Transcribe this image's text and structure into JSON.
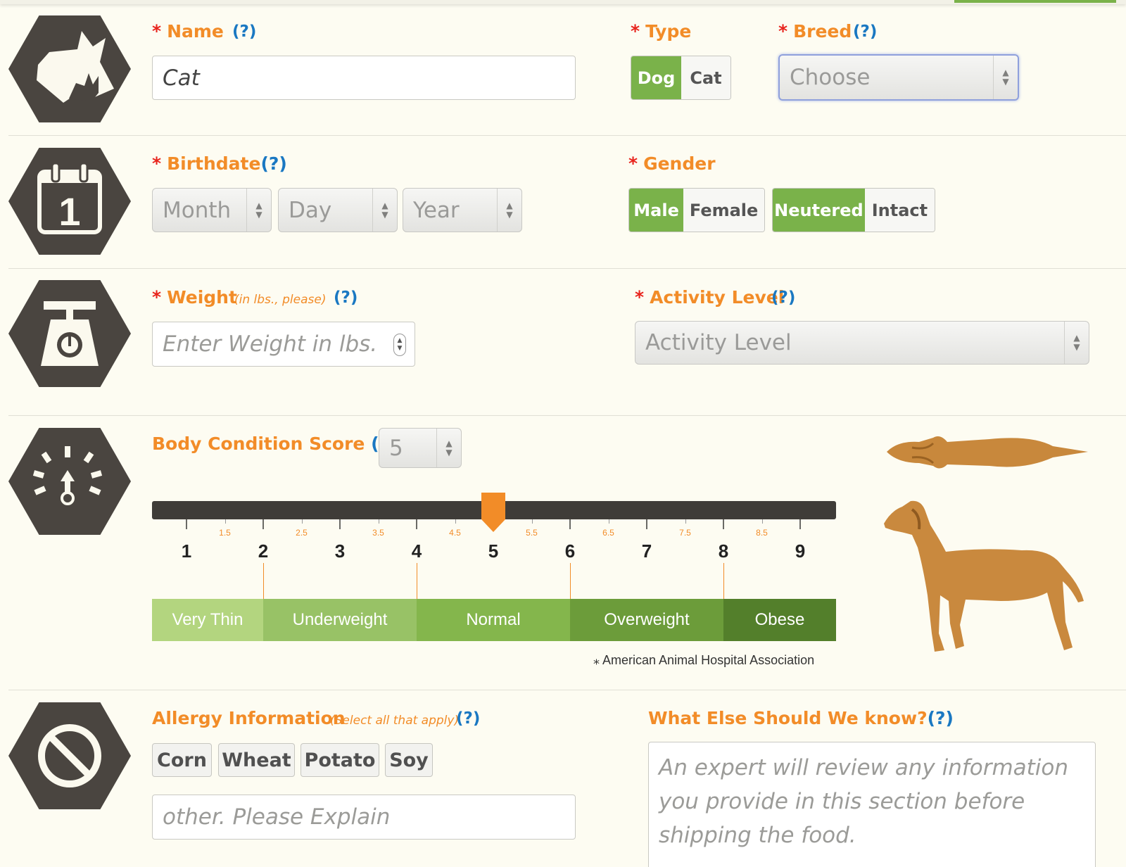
{
  "name_field": {
    "label": "Name",
    "help": "(?)",
    "value": "Cat"
  },
  "type_field": {
    "label": "Type",
    "options": [
      "Dog",
      "Cat"
    ],
    "selected": "Dog"
  },
  "breed_field": {
    "label": "Breed",
    "help": "(?)",
    "value": "Choose"
  },
  "birthdate_field": {
    "label": "Birthdate",
    "help": "(?)",
    "month": "Month",
    "day": "Day",
    "year": "Year"
  },
  "gender_field": {
    "label": "Gender",
    "sex_options": [
      "Male",
      "Female"
    ],
    "sex_selected": "Male",
    "status_options": [
      "Neutered",
      "Intact"
    ],
    "status_selected": "Neutered"
  },
  "weight_field": {
    "label": "Weight",
    "note": "(in lbs., please)",
    "help": "(?)",
    "placeholder": "Enter Weight in lbs."
  },
  "activity_field": {
    "label": "Activity Level",
    "help": "(?)",
    "value": "Activity Level"
  },
  "bcs": {
    "label": "Body Condition Score",
    "help": "(?)",
    "value": "5",
    "major_ticks": [
      "1",
      "2",
      "3",
      "4",
      "5",
      "6",
      "7",
      "8",
      "9"
    ],
    "minor_ticks": [
      "1.5",
      "2.5",
      "3.5",
      "4.5",
      "5.5",
      "6.5",
      "7.5",
      "8.5"
    ],
    "categories": [
      "Very Thin",
      "Underweight",
      "Normal",
      "Overweight",
      "Obese"
    ],
    "category_colors": [
      "#b3d57f",
      "#98c266",
      "#84b64c",
      "#6c9c3a",
      "#537f2b"
    ],
    "accent_color": "#f28c28",
    "source": "American Animal Hospital Association"
  },
  "allergy_field": {
    "label": "Allergy Information",
    "note": "(Select all that apply)",
    "help": "(?)",
    "options": [
      "Corn",
      "Wheat",
      "Potato",
      "Soy"
    ],
    "other_placeholder": "other. Please Explain"
  },
  "notes_field": {
    "label": "What Else Should We know?",
    "help": "(?)",
    "placeholder": "An expert will review any information you provide in this section before shipping the food."
  }
}
